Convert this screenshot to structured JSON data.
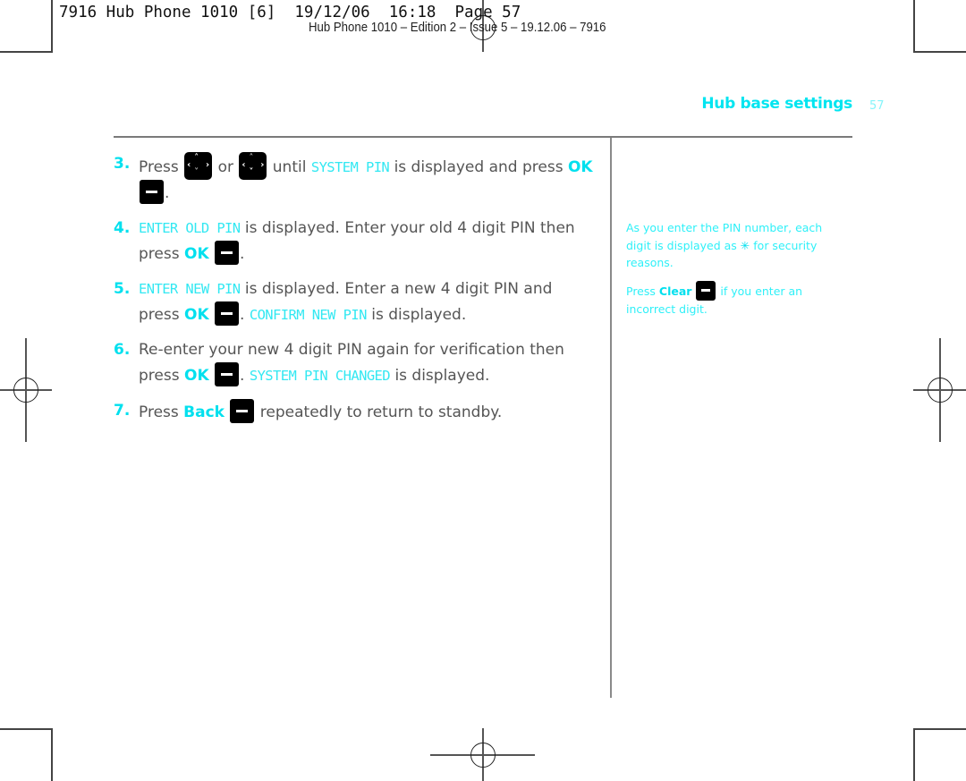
{
  "print_slug": {
    "line1": "7916 Hub Phone 1010 [6]  19/12/06  16:18  Page 57",
    "line2": "Hub Phone 1010 – Edition 2 – Issue 5 – 19.12.06 – 7916"
  },
  "header": {
    "section_title": "Hub base settings",
    "page_number": "57"
  },
  "steps": [
    {
      "number": "3.",
      "parts": {
        "t1": "Press",
        "t2": "or",
        "t3": "until",
        "display": "SYSTEM PIN",
        "t4": "is displayed and press",
        "key_label": "OK",
        "t5": "."
      },
      "icons": [
        "nav-up-icon",
        "nav-down-icon",
        "minus-softkey-icon"
      ]
    },
    {
      "number": "4.",
      "parts": {
        "display": "ENTER OLD PIN",
        "t1": "is displayed. Enter your old 4 digit PIN then press",
        "key_label": "OK",
        "t2": "."
      },
      "icons": [
        "minus-softkey-icon"
      ]
    },
    {
      "number": "5.",
      "parts": {
        "display": "ENTER NEW PIN",
        "t1": "is displayed. Enter a new 4 digit PIN and press",
        "key_label": "OK",
        "t2": ".",
        "display2": "CONFIRM NEW PIN",
        "t3": "is displayed."
      },
      "icons": [
        "minus-softkey-icon"
      ]
    },
    {
      "number": "6.",
      "parts": {
        "t1": "Re-enter your new 4 digit PIN again for verification then press",
        "key_label": "OK",
        "t2": ".",
        "display": "SYSTEM PIN CHANGED",
        "t3": "is displayed."
      },
      "icons": [
        "minus-softkey-icon"
      ]
    },
    {
      "number": "7.",
      "parts": {
        "t1": "Press",
        "key_label": "Back",
        "t2": "repeatedly to return to standby."
      },
      "icons": [
        "minus-softkey-icon"
      ]
    }
  ],
  "sidebar_notes": [
    {
      "t1": "As you enter the PIN number, each digit is displayed as",
      "symbol": "✳",
      "t2": "for security reasons."
    },
    {
      "t1": "Press",
      "key_label": "Clear",
      "t2": "if you enter an incorrect digit."
    }
  ],
  "nav_glyphs": {
    "up": "˄",
    "down": "˅",
    "left": "‹",
    "right": "›"
  },
  "colors": {
    "accent": "#00e0ee",
    "body_text": "#555555",
    "key_bg": "#000000"
  }
}
